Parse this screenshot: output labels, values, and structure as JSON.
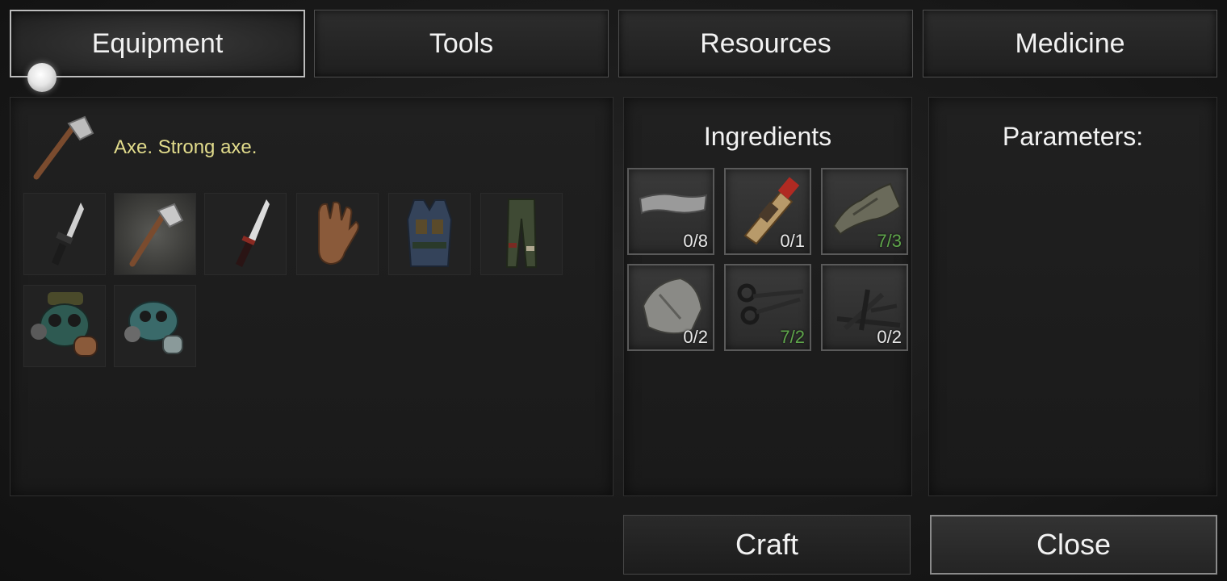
{
  "tabs": [
    {
      "label": "Equipment",
      "active": true
    },
    {
      "label": "Tools",
      "active": false
    },
    {
      "label": "Resources",
      "active": false
    },
    {
      "label": "Medicine",
      "active": false
    }
  ],
  "selected_item": {
    "icon": "axe-icon",
    "description": "Axe. Strong axe."
  },
  "items": [
    {
      "icon": "knife-icon"
    },
    {
      "icon": "axe-icon",
      "selected": true
    },
    {
      "icon": "combat-knife-icon"
    },
    {
      "icon": "gloves-icon"
    },
    {
      "icon": "vest-icon"
    },
    {
      "icon": "pants-icon"
    },
    {
      "icon": "gas-mask-goggles-icon"
    },
    {
      "icon": "gas-mask-icon"
    }
  ],
  "ingredients": {
    "title": "Ingredients",
    "items": [
      {
        "icon": "metal-scrap-icon",
        "count": "0/8",
        "enough": false
      },
      {
        "icon": "glue-tube-icon",
        "count": "0/1",
        "enough": false
      },
      {
        "icon": "cloth-icon",
        "count": "7/3",
        "enough": true
      },
      {
        "icon": "stone-icon",
        "count": "0/2",
        "enough": false
      },
      {
        "icon": "scissors-icon",
        "count": "7/2",
        "enough": true
      },
      {
        "icon": "sticks-icon",
        "count": "0/2",
        "enough": false
      }
    ]
  },
  "parameters": {
    "title": "Parameters:"
  },
  "buttons": {
    "craft": "Craft",
    "close": "Close"
  },
  "colors": {
    "description": "#e2dc8c",
    "count_ok": "#5fa64b",
    "count_missing": "#e8e8e8"
  }
}
